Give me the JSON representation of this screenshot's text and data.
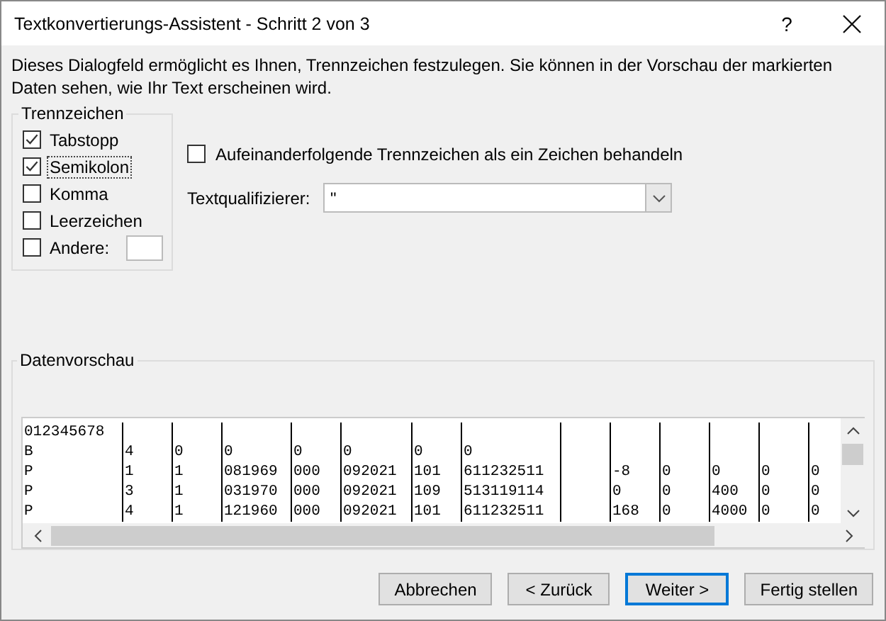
{
  "window": {
    "title": "Textkonvertierungs-Assistent - Schritt 2 von 3",
    "help": "?"
  },
  "description": "Dieses Dialogfeld ermöglicht es Ihnen, Trennzeichen festzulegen. Sie können in der Vorschau der markierten Daten sehen, wie Ihr Text erscheinen wird.",
  "delimiters": {
    "title": "Trennzeichen",
    "items": [
      {
        "label": "Tabstopp",
        "checked": true,
        "focused": false
      },
      {
        "label": "Semikolon",
        "checked": true,
        "focused": true
      },
      {
        "label": "Komma",
        "checked": false,
        "focused": false
      },
      {
        "label": "Leerzeichen",
        "checked": false,
        "focused": false
      },
      {
        "label": "Andere:",
        "checked": false,
        "focused": false,
        "kind": "other"
      }
    ]
  },
  "consecutive": {
    "label": "Aufeinanderfolgende Trennzeichen als ein Zeichen behandeln",
    "checked": false
  },
  "text_qualifier": {
    "label": "Textqualifizierer:",
    "value": "\""
  },
  "preview": {
    "title": "Datenvorschau",
    "rows": [
      [
        "012345678",
        null,
        null,
        null,
        null,
        null,
        null,
        null,
        null,
        null,
        null,
        null,
        null,
        null
      ],
      [
        "B",
        "4",
        "0",
        "0",
        "0",
        "0",
        "0",
        "0",
        null,
        null,
        null,
        null,
        null,
        null
      ],
      [
        "P",
        "1",
        "1",
        "081969",
        "000",
        "092021",
        "101",
        "611232511",
        null,
        "-8",
        "0",
        "0",
        "0",
        "0"
      ],
      [
        "P",
        "3",
        "1",
        "031970",
        "000",
        "092021",
        "109",
        "513119114",
        null,
        "0",
        "0",
        "400",
        "0",
        "0"
      ],
      [
        "P",
        "4",
        "1",
        "121960",
        "000",
        "092021",
        "101",
        "611232511",
        null,
        "168",
        "0",
        "4000",
        "0",
        "0"
      ]
    ]
  },
  "buttons": [
    {
      "label": "Abbrechen",
      "default": false
    },
    {
      "label": "< Zurück",
      "default": false
    },
    {
      "label": "Weiter >",
      "default": true
    },
    {
      "label": "Fertig stellen",
      "default": false
    }
  ]
}
